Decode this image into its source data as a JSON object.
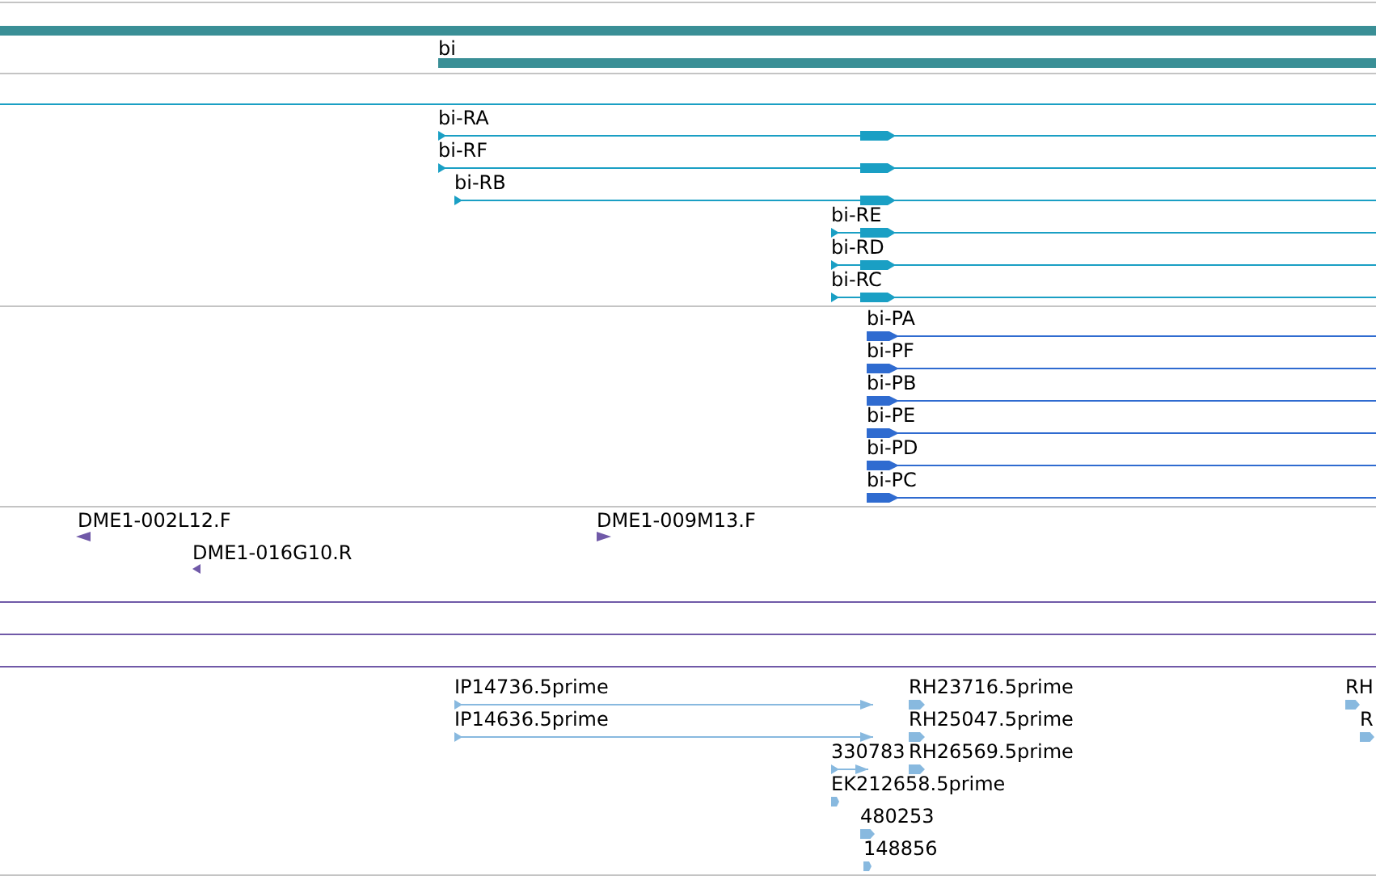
{
  "tracks": [
    {
      "kind": "gene",
      "features": [
        {
          "label": "bi"
        }
      ]
    },
    {
      "kind": "transcript",
      "features": [
        {
          "label": "bi-RA"
        },
        {
          "label": "bi-RF"
        },
        {
          "label": "bi-RB"
        },
        {
          "label": "bi-RE"
        },
        {
          "label": "bi-RD"
        },
        {
          "label": "bi-RC"
        }
      ]
    },
    {
      "kind": "protein",
      "features": [
        {
          "label": "bi-PA"
        },
        {
          "label": "bi-PF"
        },
        {
          "label": "bi-PB"
        },
        {
          "label": "bi-PE"
        },
        {
          "label": "bi-PD"
        },
        {
          "label": "bi-PC"
        }
      ]
    },
    {
      "kind": "clone",
      "features": [
        {
          "label": "DME1-002L12.F",
          "reverse": true
        },
        {
          "label": "DME1-016G10.R",
          "reverse": true
        },
        {
          "label": "DME1-009M13.F",
          "reverse": false
        }
      ]
    },
    {
      "kind": "est",
      "features": [
        {
          "label": "IP14736.5prime"
        },
        {
          "label": "IP14636.5prime"
        },
        {
          "label": "RH23716.5prime"
        },
        {
          "label": "RH25047.5prime"
        },
        {
          "label": "330783"
        },
        {
          "label": "RH26569.5prime"
        },
        {
          "label": "EK212658.5prime"
        },
        {
          "label": "480253"
        },
        {
          "label": "148856"
        },
        {
          "label": "RH"
        },
        {
          "label": "R"
        }
      ]
    }
  ]
}
